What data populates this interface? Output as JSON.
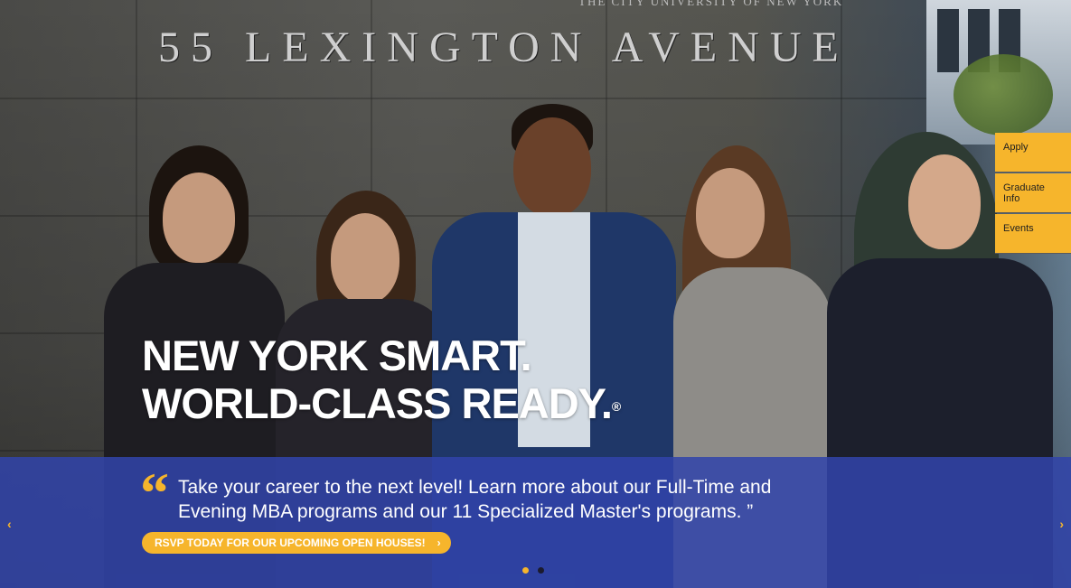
{
  "hero": {
    "building_sign": "55 LEXINGTON AVENUE",
    "building_sign_small": "THE CITY UNIVERSITY OF NEW YORK",
    "headline_line1": "NEW YORK SMART.",
    "headline_line2": "WORLD-CLASS READY.",
    "headline_mark": "®"
  },
  "band": {
    "quote_mark": "“",
    "quote_line1": "Take your career to the next level! Learn more about our Full-Time and",
    "quote_line2": "Evening MBA programs and our 11 Specialized Master's programs. ”",
    "cta_label": "RSVP TODAY FOR OUR UPCOMING OPEN HOUSES!",
    "cta_icon": "›",
    "prev_icon": "‹",
    "next_icon": "›"
  },
  "slider": {
    "dots": [
      {
        "active": true,
        "color": "#f6b52c"
      },
      {
        "active": false,
        "color": "#1b1b2e"
      }
    ]
  },
  "side_links": [
    {
      "label": "Apply"
    },
    {
      "label": "Graduate Info"
    },
    {
      "label": "Events"
    }
  ],
  "colors": {
    "accent": "#f6b52c",
    "band": "#3144aa"
  }
}
